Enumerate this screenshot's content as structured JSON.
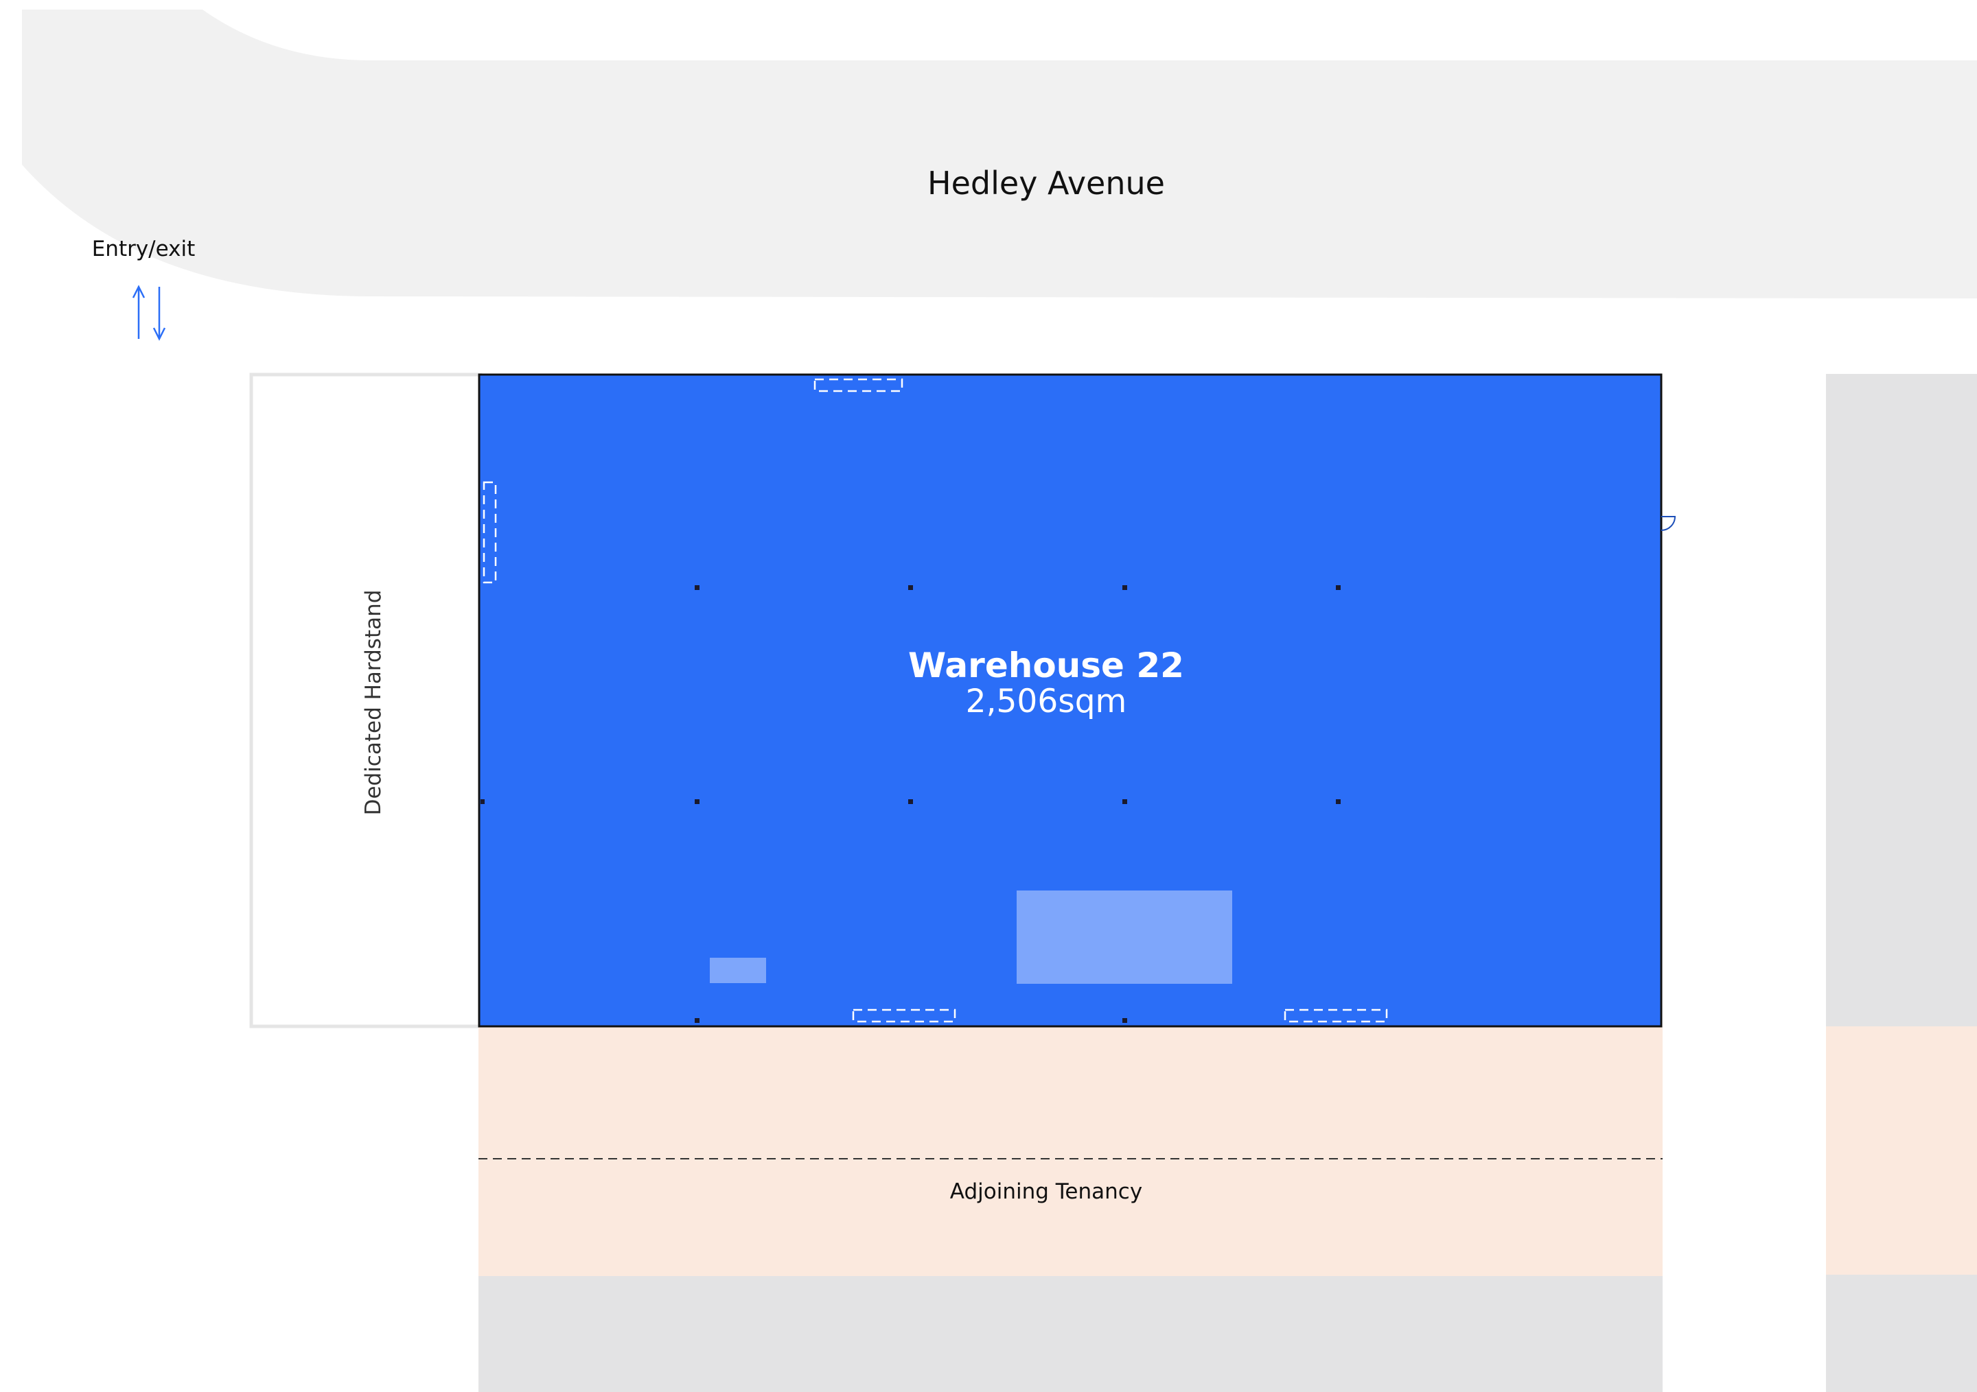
{
  "street": {
    "name": "Hedley Avenue"
  },
  "access": {
    "label": "Entry/exit"
  },
  "hardstand": {
    "label": "Dedicated Hardstand"
  },
  "warehouse": {
    "name": "Warehouse 22",
    "area": "2,506sqm"
  },
  "adjoining": {
    "label": "Adjoining Tenancy"
  },
  "colors": {
    "road": "#f1f1f1",
    "warehouse": "#2b6ef7",
    "warehouse_inner": "#7ea6fb",
    "adjoining": "#fbe9de",
    "neighbour": "#e3e3e4",
    "outline": "#e5e5e5",
    "arrow": "#2b6ef7"
  }
}
